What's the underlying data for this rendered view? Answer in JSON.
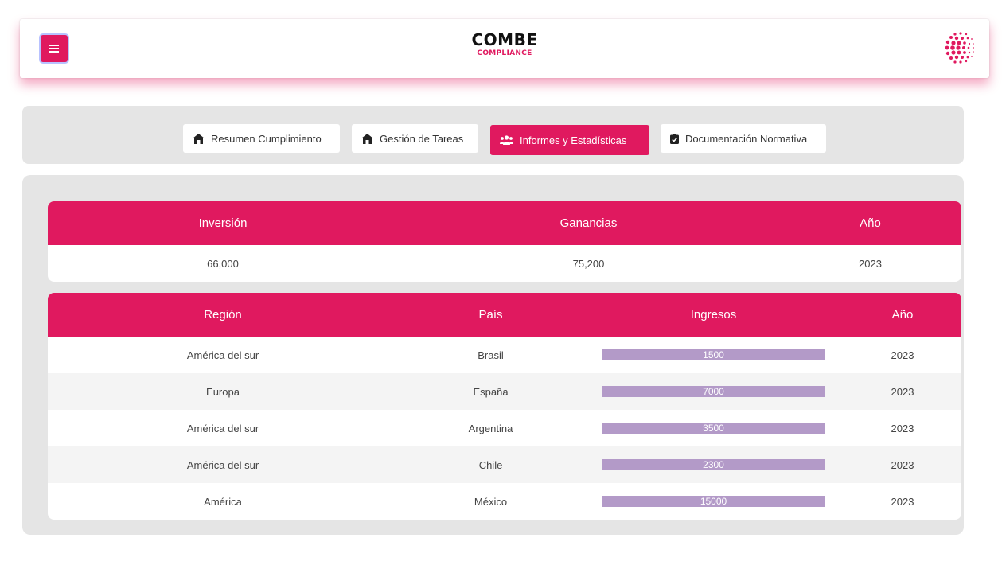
{
  "header": {
    "brand_title": "COMBE",
    "brand_subtitle": "COMPLIANCE",
    "menu_icon": "hamburger-icon",
    "logo_icon": "dotted-sphere-logo"
  },
  "nav": {
    "tabs": [
      {
        "label": "Resumen Cumplimiento",
        "icon": "house-icon",
        "active": false
      },
      {
        "label": "Gestión de Tareas",
        "icon": "house-icon",
        "active": false
      },
      {
        "label": "Informes y Estadísticas",
        "icon": "users-icon",
        "active": true
      },
      {
        "label": "Documentación Normativa",
        "icon": "clipboard-check-icon",
        "active": false
      }
    ]
  },
  "summary_table": {
    "headers": [
      "Inversión",
      "Ganancias",
      "Año"
    ],
    "row": [
      "66,000",
      "75,200",
      "2023"
    ]
  },
  "detail_table": {
    "headers": [
      "Región",
      "País",
      "Ingresos",
      "Año"
    ],
    "rows": [
      {
        "region": "América del sur",
        "pais": "Brasil",
        "ingresos": "1500",
        "anio": "2023"
      },
      {
        "region": "Europa",
        "pais": "España",
        "ingresos": "7000",
        "anio": "2023"
      },
      {
        "region": "América del sur",
        "pais": "Argentina",
        "ingresos": "3500",
        "anio": "2023"
      },
      {
        "region": "América del sur",
        "pais": "Chile",
        "ingresos": "2300",
        "anio": "2023"
      },
      {
        "region": "América",
        "pais": "México",
        "ingresos": "15000",
        "anio": "2023"
      }
    ]
  },
  "colors": {
    "accent": "#e0195f",
    "panel": "#e5e5e5",
    "bar": "#b39ac8"
  }
}
